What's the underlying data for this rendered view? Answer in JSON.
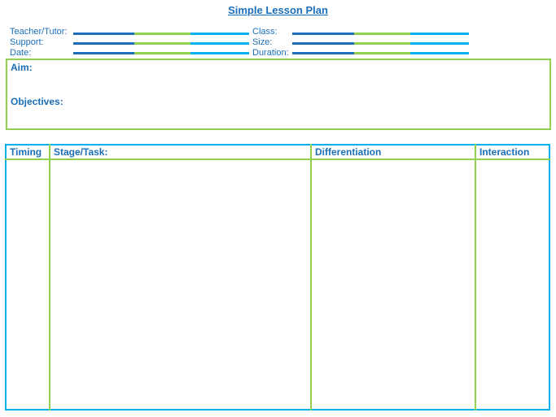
{
  "document": {
    "title": "Simple Lesson Plan"
  },
  "header_fields": {
    "left": [
      {
        "label": "Teacher/Tutor:"
      },
      {
        "label": "Support:"
      },
      {
        "label": "Date:"
      }
    ],
    "right": [
      {
        "label": "Class:"
      },
      {
        "label": "Size:"
      },
      {
        "label": "Duration:"
      }
    ]
  },
  "aim_box": {
    "aim_label": "Aim:",
    "objectives_label": "Objectives:"
  },
  "plan_table": {
    "columns": [
      "Timing",
      "Stage/Task:",
      "Differentiation",
      "Interaction"
    ]
  },
  "colors": {
    "text_blue": "#1a6fb8",
    "accent_green": "#92d050",
    "accent_cyan": "#00b0f0"
  }
}
